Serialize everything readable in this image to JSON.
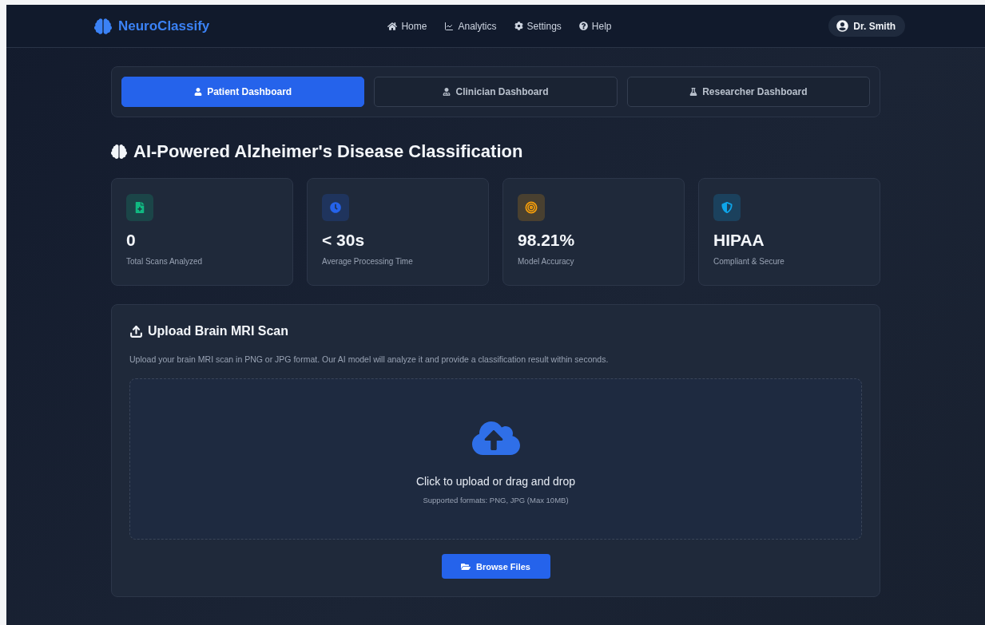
{
  "brand": {
    "name": "NeuroClassify"
  },
  "nav": [
    {
      "kind": "home",
      "label": "Home"
    },
    {
      "kind": "analytics",
      "label": "Analytics"
    },
    {
      "kind": "settings",
      "label": "Settings"
    },
    {
      "kind": "help",
      "label": "Help"
    }
  ],
  "user": {
    "name": "Dr. Smith"
  },
  "tabs": [
    {
      "kind": "patient",
      "label": "Patient Dashboard",
      "selected": true
    },
    {
      "kind": "clinician",
      "label": "Clinician Dashboard",
      "selected": false
    },
    {
      "kind": "researcher",
      "label": "Researcher Dashboard",
      "selected": false
    }
  ],
  "page_title": "AI-Powered Alzheimer's Disease Classification",
  "stats": [
    {
      "kind": "scans",
      "value": "0",
      "label": "Total Scans Analyzed",
      "color": "#10b981"
    },
    {
      "kind": "time",
      "value": "< 30s",
      "label": "Average Processing Time",
      "color": "#2563eb"
    },
    {
      "kind": "accuracy",
      "value": "98.21%",
      "label": "Model Accuracy",
      "color": "#f59e0b"
    },
    {
      "kind": "security",
      "value": "HIPAA",
      "label": "Compliant & Secure",
      "color": "#0ea5e9"
    }
  ],
  "upload": {
    "title": "Upload Brain MRI Scan",
    "description": "Upload your brain MRI scan in PNG or JPG format. Our AI model will analyze it and provide a classification result within seconds.",
    "dropzone": {
      "prompt": "Click to upload or drag and drop",
      "hint": "Supported formats: PNG, JPG (Max 10MB)"
    },
    "button": "Browse Files"
  }
}
